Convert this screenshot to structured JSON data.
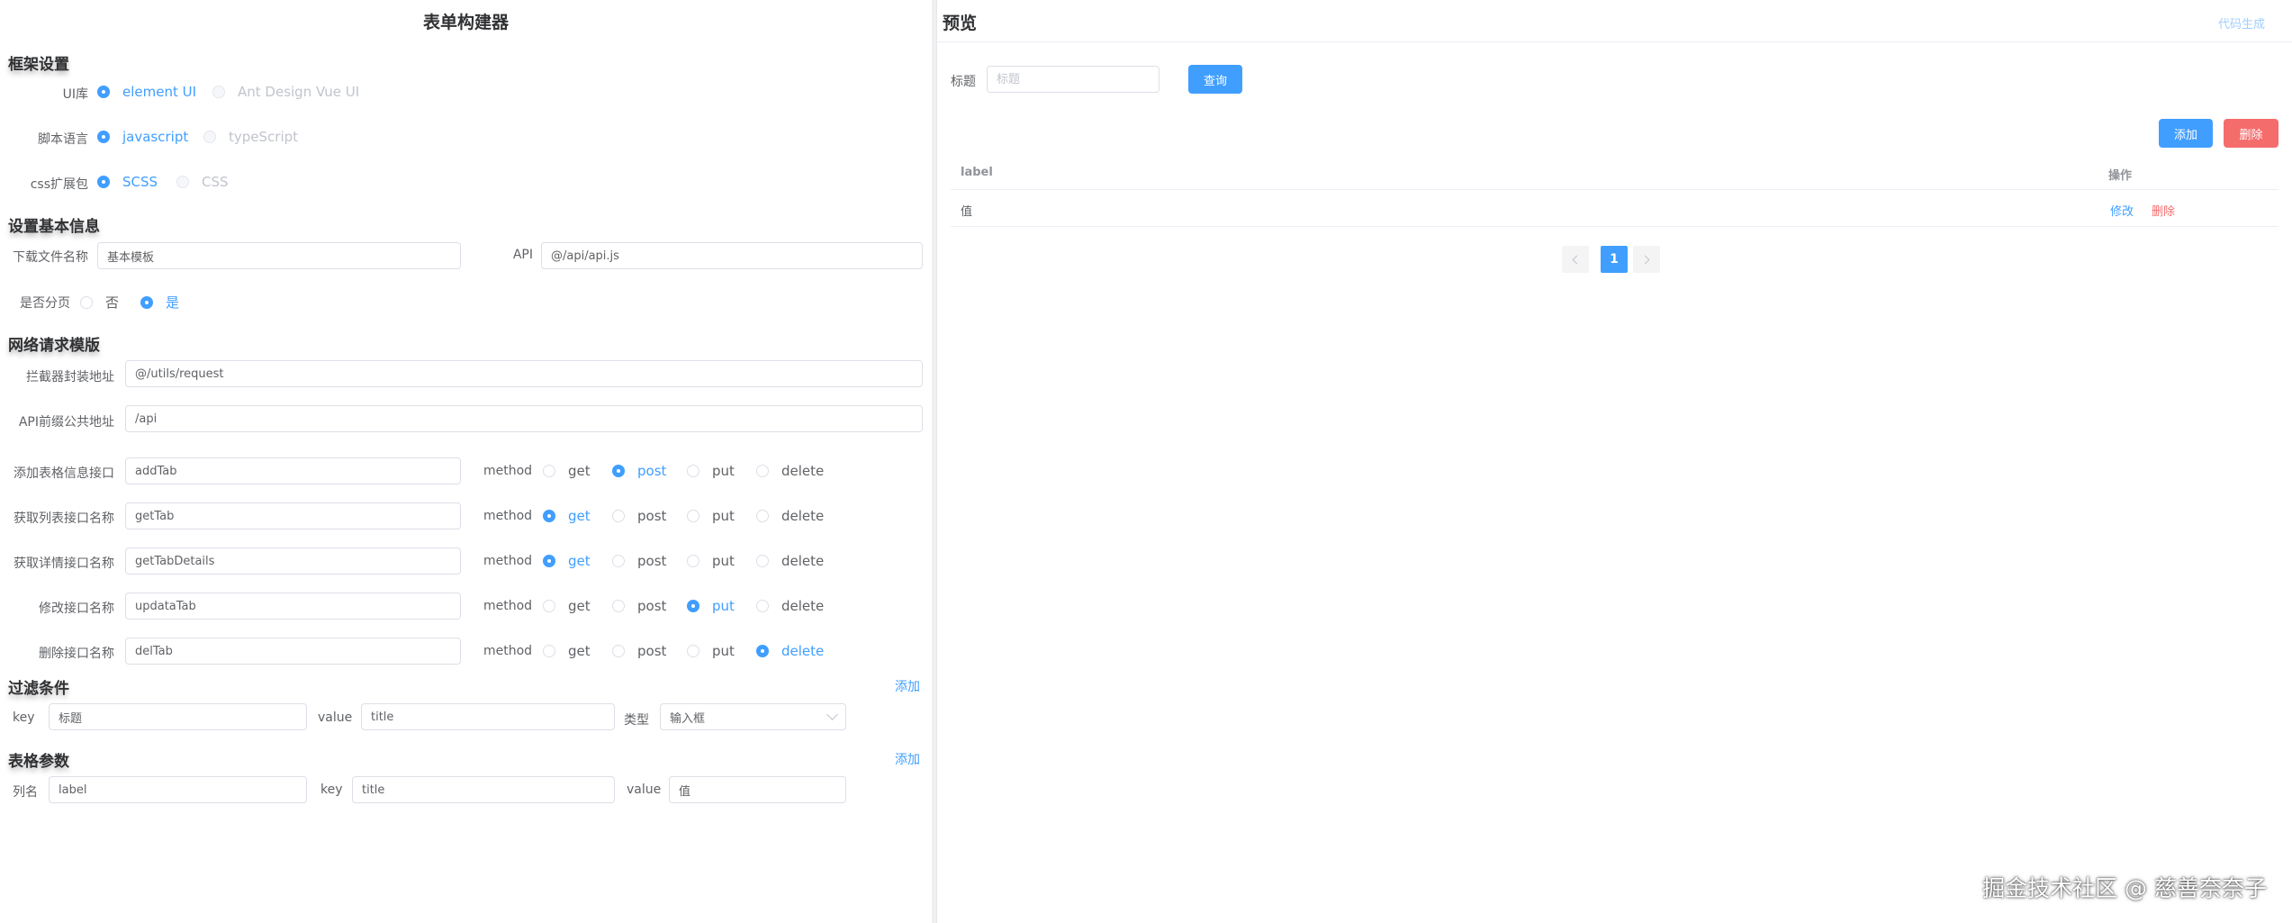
{
  "builder": {
    "title": "表单构建器",
    "framework_section": "框架设置",
    "ui_lib": {
      "label": "UI库",
      "options": [
        "element UI",
        "Ant Design Vue UI"
      ],
      "selected": 0
    },
    "script_lang": {
      "label": "脚本语言",
      "options": [
        "javascript",
        "typeScript"
      ],
      "selected": 0
    },
    "css_ext": {
      "label": "css扩展包",
      "options": [
        "SCSS",
        "CSS"
      ],
      "selected": 0
    },
    "basic_section": "设置基本信息",
    "download_name": {
      "label": "下载文件名称",
      "value": "基本模板"
    },
    "api_file": {
      "label": "API",
      "value": "@/api/api.js"
    },
    "paging": {
      "label": "是否分页",
      "options": [
        "否",
        "是"
      ],
      "selected": 1
    },
    "network_section": "网络请求模版",
    "interceptor": {
      "label": "拦截器封装地址",
      "value": "@/utils/request"
    },
    "api_prefix": {
      "label": "API前缀公共地址",
      "value": "/api"
    },
    "method_label": "method",
    "methods": [
      "get",
      "post",
      "put",
      "delete"
    ],
    "endpoints": [
      {
        "label": "添加表格信息接口",
        "value": "addTab",
        "method": "post"
      },
      {
        "label": "获取列表接口名称",
        "value": "getTab",
        "method": "get"
      },
      {
        "label": "获取详情接口名称",
        "value": "getTabDetails",
        "method": "get"
      },
      {
        "label": "修改接口名称",
        "value": "updataTab",
        "method": "put"
      },
      {
        "label": "删除接口名称",
        "value": "delTab",
        "method": "delete"
      }
    ],
    "filter_section": "过滤条件",
    "filter_add": "添加",
    "filter": {
      "key_label": "key",
      "key_value": "标题",
      "value_label": "value",
      "value_value": "title",
      "type_label": "类型",
      "type_value": "输入框"
    },
    "table_section": "表格参数",
    "table_add": "添加",
    "table_param": {
      "col_label": "列名",
      "col_value": "label",
      "key_label": "key",
      "key_value": "title",
      "value_label": "value",
      "value_value": "值"
    }
  },
  "preview": {
    "title": "预览",
    "code_gen": "代码生成",
    "search_label": "标题",
    "search_placeholder": "标题",
    "query_button": "查询",
    "add_button": "添加",
    "delete_button": "删除",
    "table": {
      "headers": [
        "label",
        "操作"
      ],
      "row": {
        "label": "值",
        "edit": "修改",
        "delete": "删除"
      }
    },
    "pagination": {
      "current": "1"
    }
  },
  "watermark": "掘金技术社区 @ 慈善奈奈子",
  "colors": {
    "primary": "#409eff",
    "danger": "#f56c6c",
    "text": "#606266",
    "border": "#dcdfe6"
  }
}
